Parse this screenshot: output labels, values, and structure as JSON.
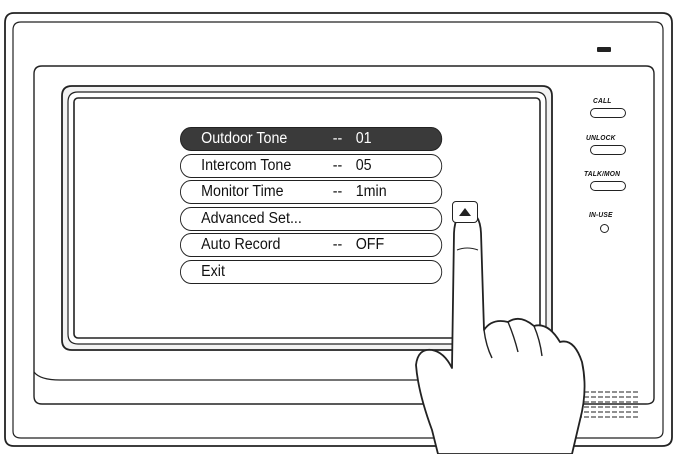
{
  "menu": {
    "items": [
      {
        "label": "Outdoor Tone",
        "sep": "--",
        "value": "01",
        "selected": true
      },
      {
        "label": "Intercom Tone",
        "sep": "--",
        "value": "05",
        "selected": false
      },
      {
        "label": "Monitor Time",
        "sep": "--",
        "value": "1min",
        "selected": false
      },
      {
        "label": "Advanced Set...",
        "sep": "",
        "value": "",
        "selected": false
      },
      {
        "label": "Auto Record",
        "sep": "--",
        "value": "OFF",
        "selected": false
      },
      {
        "label": "Exit",
        "sep": "",
        "value": "",
        "selected": false
      }
    ]
  },
  "side_panel": {
    "call_label": "CALL",
    "unlock_label": "UNLOCK",
    "talk_mon_label": "TALK/MON",
    "in_use_label": "IN-USE"
  },
  "icons": {
    "scroll": "up-arrow-icon",
    "hand": "pointing-hand-icon",
    "speaker": "speaker-grille-icon",
    "indicator": "indicator-light-icon"
  },
  "colors": {
    "selected_bg": "#3a3a3a",
    "housing": "#ffffff",
    "line": "#222222"
  }
}
